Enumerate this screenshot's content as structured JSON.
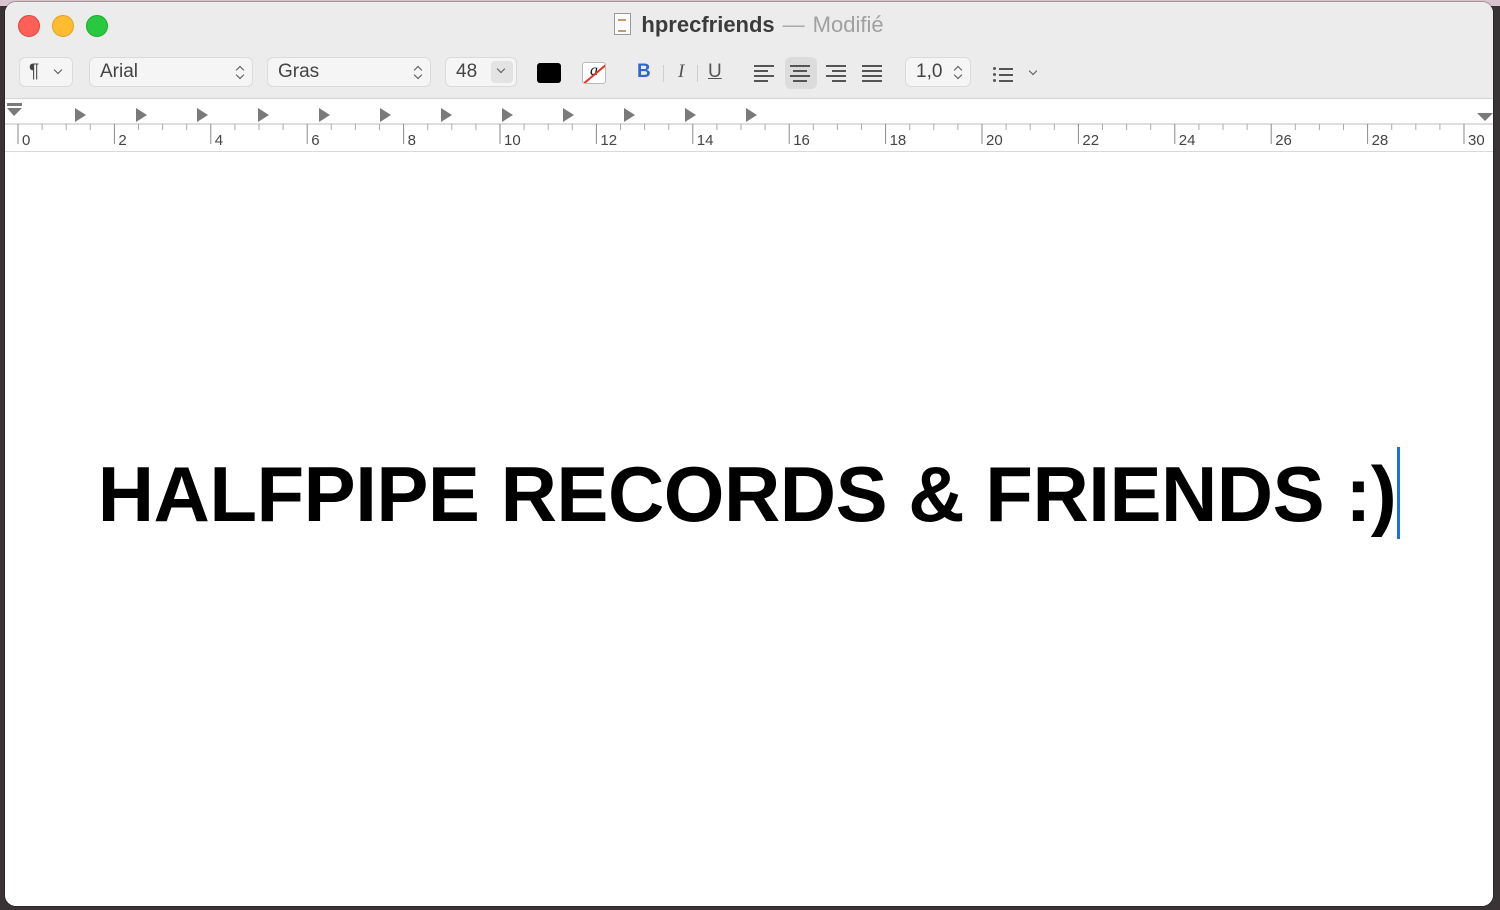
{
  "window": {
    "filename": "hprecfriends",
    "separator": "—",
    "status": "Modifié"
  },
  "traffic_lights": {
    "close_color": "#fe5f57",
    "minimize_color": "#febc2e",
    "maximize_color": "#28c840"
  },
  "toolbar": {
    "paragraph_style_glyph": "¶",
    "font_family": "Arial",
    "font_style": "Gras",
    "font_size": "48",
    "text_color": "#000000",
    "highlight_glyph": "a",
    "bold_label": "B",
    "italic_label": "I",
    "underline_label": "U",
    "line_spacing": "1,0",
    "alignment_selected": "center"
  },
  "ruler": {
    "labels": [
      "0",
      "2",
      "4",
      "6",
      "8",
      "10",
      "12",
      "14",
      "16",
      "18",
      "20",
      "22",
      "24",
      "26",
      "28",
      "30"
    ]
  },
  "document": {
    "text": "HALFPIPE RECORDS & FRIENDS :)"
  }
}
